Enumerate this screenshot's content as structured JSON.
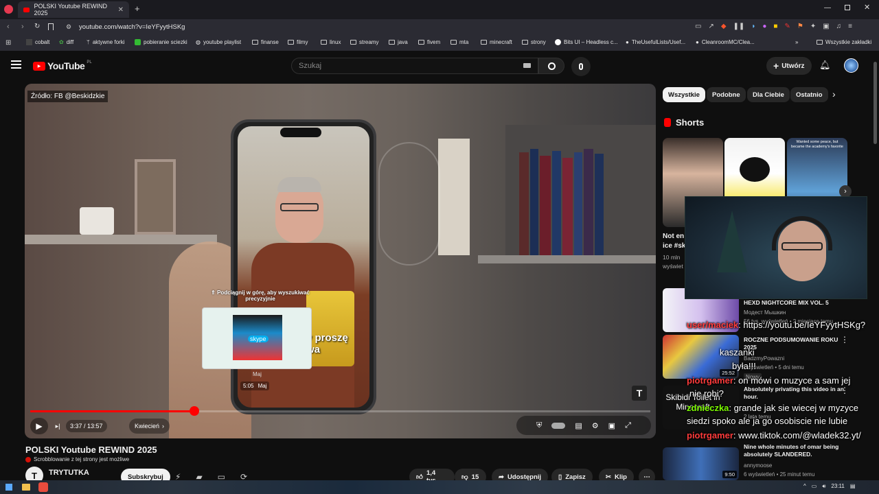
{
  "browser": {
    "tab_title": "POLSKI Youtube REWIND 2025",
    "url": "youtube.com/watch?v=IeYFyytHSKg",
    "bookmarks": [
      "cobalt",
      "diff",
      "aktywne forki",
      "pobieranie sciezki",
      "youtube playlist",
      "finanse",
      "filmy",
      "linux",
      "streamy",
      "java",
      "fivem",
      "mta",
      "minecraft",
      "strony",
      "Bits UI – Headless c...",
      "TheUsefulLists/Usef...",
      "CleanroomMC/Clea..."
    ],
    "all_bookmarks": "Wszystkie zakładki",
    "more": "»"
  },
  "youtube": {
    "logo": "YouTube",
    "region": "PL",
    "search_placeholder": "Szukaj",
    "create_label": "Utwórz"
  },
  "video": {
    "source_label": "Źródło: FB @Beskidzkie",
    "swipe_hint": "⇑ Podciągnij w górę, aby wyszukiwać precyzyjnie",
    "preview_label": "Maj",
    "preview_time": "5:05",
    "preview_chapter": "Maj",
    "current_time": "3:37 / 13:57",
    "chapter": "Kwiecień",
    "progress_fraction": 0.265,
    "caption": "y proszę\nwa"
  },
  "below": {
    "title": "POLSKI Youtube REWIND 2025",
    "scrobble": "Scrobblowanie z tej strony jest możliwe",
    "channel": "TRYTUTKA",
    "subscribe": "Subskrybuj",
    "likes": "1,4 tys.",
    "dislikes": "15",
    "share": "Udostępnij",
    "save": "Zapisz",
    "clip": "Klip"
  },
  "sidebar": {
    "chips": [
      "Wszystkie",
      "Podobne",
      "Dla Ciebie",
      "Ostatnio"
    ],
    "shorts_heading": "Shorts",
    "short_text_1": "Not en\nice #sk",
    "short_views_1": "10 mln\nwyświet",
    "short_caption_3": "Wanted some peace, but became the academy's favorite",
    "recommended": [
      {
        "title": "HEXD NIGHTCORE MIX VOL. 5",
        "channel": "Модест Мышкин",
        "meta": "56 tys. wyświetleń • 2 miesiące temu"
      },
      {
        "title": "ROCZNE PODSUMOWANIE ROKU 2025",
        "channel": "BadzmyPowazni",
        "meta": ". wyświetleń • 5 dni temu",
        "duration": "25:52",
        "badge": "Nowy"
      },
      {
        "title": "Absolutely privating this video in an hour.",
        "channel": "2 lata temu",
        "meta": "Skibidi Toilet in Minecraft"
      },
      {
        "title": "Nine whole minutes of omar being absolutely SLANDERED.",
        "channel": "annymoose",
        "meta": "6 wyświetleń • 25 minut temu",
        "duration": "9:50"
      }
    ]
  },
  "chat": [
    {
      "user": "user/maciek",
      "msg": ": https://youtu.be/IeYFyytHSKg?"
    },
    {
      "user": "",
      "msg": "kaszanki"
    },
    {
      "user": "",
      "msg": "była!!!"
    },
    {
      "user": "piotrgamer",
      "msg": ": on mówi o muzyce a sam jej"
    },
    {
      "user": "",
      "msg": "nie robi?"
    },
    {
      "user": "zdnieczka",
      "msg": ": grande jak sie wiecej w myzyce"
    },
    {
      "user": "",
      "msg": "siedzi spoko ale ja go osobiscie nie lubie"
    },
    {
      "user": "piotrgamer",
      "msg": ": www.tiktok.com/@wladek32.yt/"
    }
  ],
  "taskbar": {
    "time": "23:11"
  }
}
